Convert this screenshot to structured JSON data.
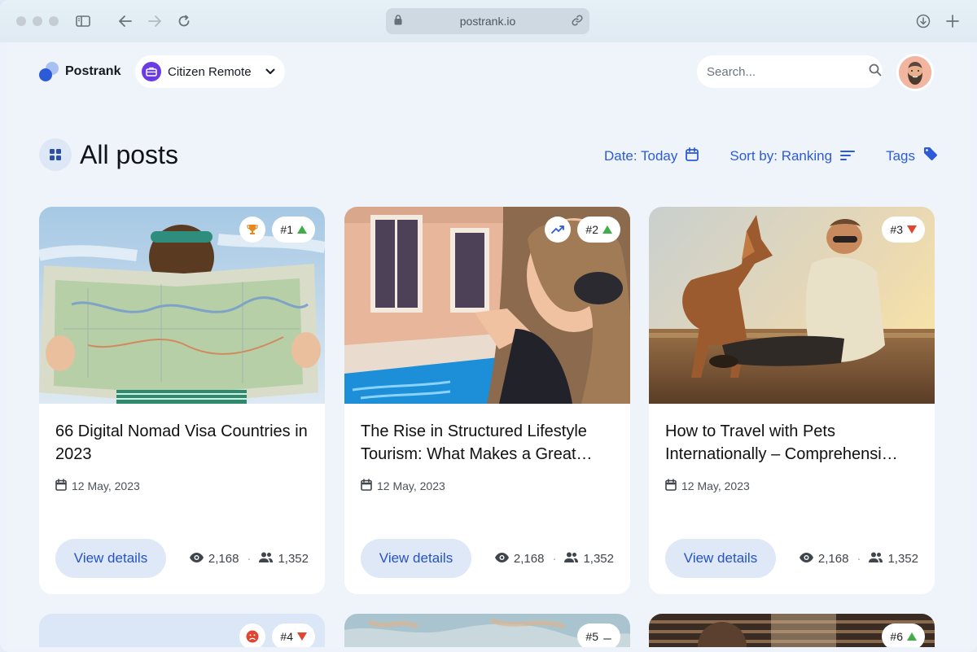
{
  "browser": {
    "url": "postrank.io",
    "traffic_lights": [
      "close",
      "minimize",
      "zoom"
    ],
    "icons": {
      "sidebar": "sidebar-icon",
      "back": "arrow-left-icon",
      "forward": "arrow-right-icon",
      "reload": "reload-icon",
      "lock": "lock-icon",
      "link": "link-icon",
      "download": "download-icon",
      "new_tab": "plus-icon"
    }
  },
  "header": {
    "logo_text": "Postrank",
    "workspace": {
      "label": "Citizen Remote",
      "icon": "briefcase-icon"
    },
    "search": {
      "placeholder": "Search...",
      "value": ""
    },
    "avatar": "user-avatar"
  },
  "main": {
    "title": "All posts",
    "filters": {
      "date": "Date: Today",
      "sort": "Sort by: Ranking",
      "tags": "Tags"
    }
  },
  "posts": [
    {
      "title": "66 Digital Nomad Visa Countries in 2023",
      "date": "12 May, 2023",
      "rank": "#1",
      "trend": "up",
      "badge": "trophy-icon",
      "views": "2,168",
      "users": "1,352",
      "cta": "View details"
    },
    {
      "title": "The Rise in Structured Lifestyle Tourism: What Makes a Great…",
      "date": "12 May, 2023",
      "rank": "#2",
      "trend": "up",
      "badge": "trending-icon",
      "views": "2,168",
      "users": "1,352",
      "cta": "View details"
    },
    {
      "title": "How to Travel with Pets Internationally – Comprehensi…",
      "date": "12 May, 2023",
      "rank": "#3",
      "trend": "down",
      "badge": "",
      "views": "2,168",
      "users": "1,352",
      "cta": "View details"
    },
    {
      "rank": "#4",
      "trend": "down",
      "badge": "sad-face-icon"
    },
    {
      "rank": "#5",
      "trend": "neutral",
      "badge": ""
    },
    {
      "rank": "#6",
      "trend": "up",
      "badge": ""
    }
  ],
  "colors": {
    "accent": "#2d5bd8",
    "trend_up": "#3fae49",
    "trend_down": "#e0452f",
    "trophy": "#e68a1d",
    "page_bg": "#eff4fb"
  }
}
